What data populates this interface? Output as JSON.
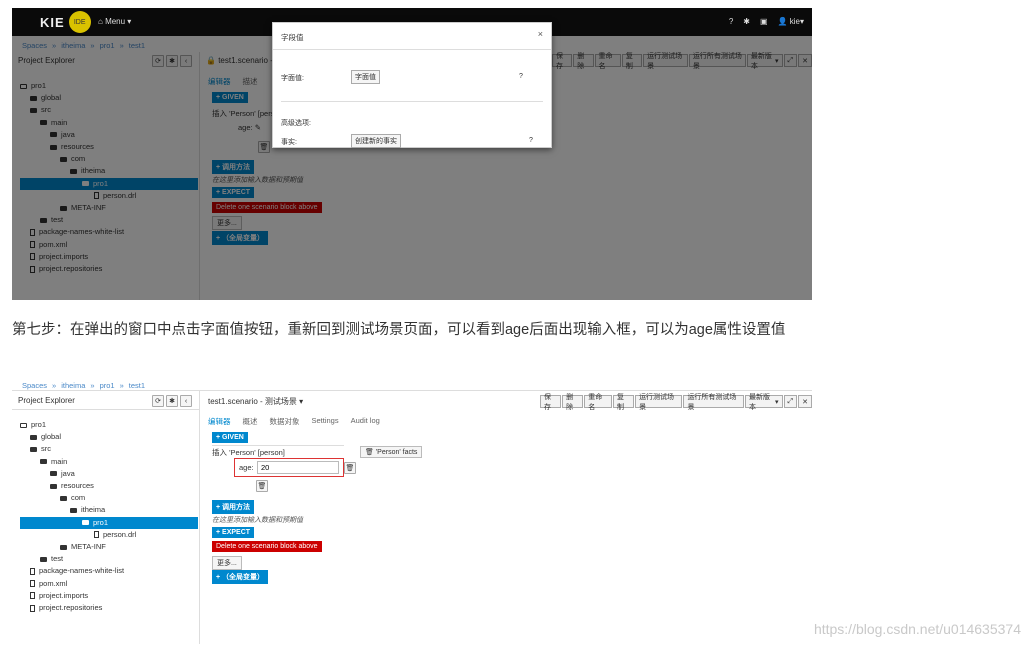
{
  "navbar": {
    "logo_text": "KIE",
    "logo_badge": "IDE",
    "menu": "Menu",
    "user": "kie",
    "icons": [
      "help-icon",
      "gear-icon",
      "camera-icon",
      "user-icon"
    ]
  },
  "breadcrumb": [
    "Spaces",
    "itheima",
    "pro1",
    "test1"
  ],
  "project_explorer": {
    "title": "Project Explorer",
    "tree": [
      "pro1",
      "global",
      "src",
      "main",
      "java",
      "resources",
      "com",
      "itheima",
      "pro1",
      "person.drl",
      "META-INF",
      "test",
      "package-names-white-list",
      "pom.xml",
      "project.imports",
      "project.repositories"
    ]
  },
  "editor1": {
    "title": "test1.scenario -",
    "toolbar": [
      "保存",
      "删除",
      "重命名",
      "复制",
      "运行测试场景",
      "运行所有测试场景",
      "最新版本"
    ],
    "tabs": [
      "编辑器",
      "描述"
    ],
    "given": "GIVEN",
    "insert_line": "插入 'Person' [pers",
    "age_label": "age:",
    "call_method": "调用方法",
    "hint": "在这里添加输入数据和预期值",
    "expect": "EXPECT",
    "delete_block": "Delete one scenario block above",
    "more": "更多...",
    "globals": "（全局变量）"
  },
  "modal": {
    "title": "字段值",
    "close": "×",
    "row1_label": "字面值:",
    "row1_button": "字面值",
    "row1_help": "?",
    "advanced": "高级选项:",
    "row2_label": "事实:",
    "row2_button": "创建新的事实",
    "row2_help": "?"
  },
  "caption": "第七步：在弹出的窗口中点击字面值按钮，重新回到测试场景页面，可以看到age后面出现输入框，可以为age属性设置值",
  "editor2": {
    "title": "test1.scenario - 测试场景",
    "toolbar": [
      "保存",
      "删除",
      "重命名",
      "复制",
      "运行测试场景",
      "运行所有测试场景",
      "最新版本"
    ],
    "tabs": [
      "编辑器",
      "概述",
      "数据对象",
      "Settings",
      "Audit log"
    ],
    "given": "GIVEN",
    "insert_line": "插入 'Person' [person]",
    "age_label": "age:",
    "age_value": "20",
    "facts": "'Person' facts",
    "call_method": "调用方法",
    "hint": "在这里添加输入数据和预期值",
    "expect": "EXPECT",
    "delete_block": "Delete one scenario block above",
    "more": "更多...",
    "globals": "（全局变量）"
  },
  "watermark": "https://blog.csdn.net/u014635374"
}
